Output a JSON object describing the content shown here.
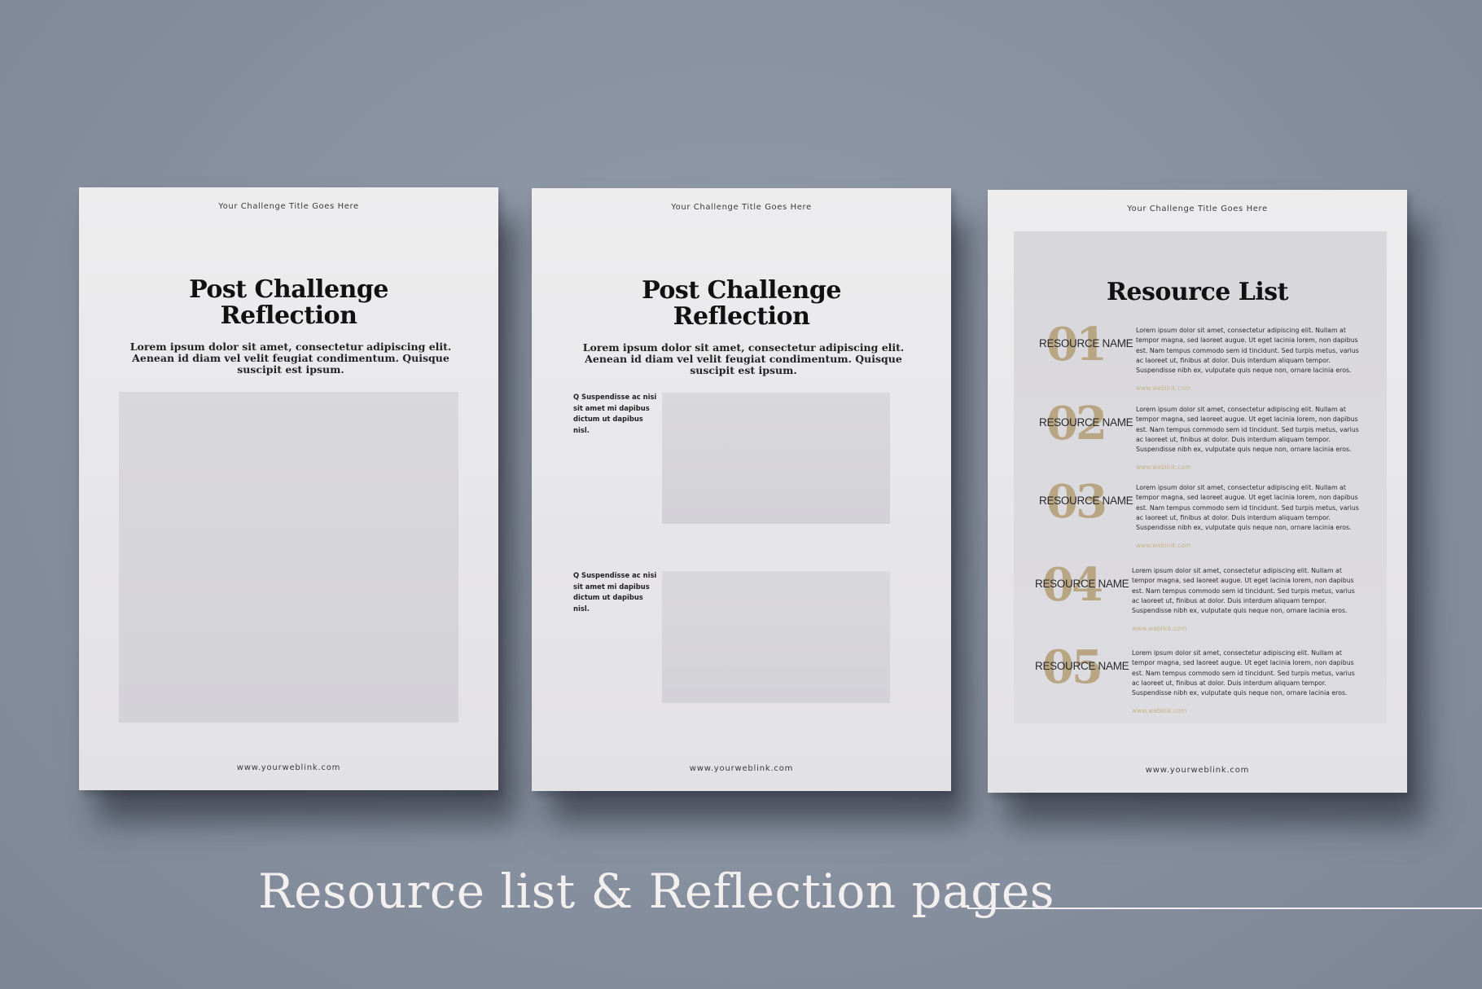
{
  "pages": [
    {
      "header": "Your Challenge Title Goes Here",
      "title_line1": "Post Challenge",
      "title_line2": "Reflection",
      "intro": "Lorem ipsum dolor sit amet, consectetur adipiscing elit. Aenean id diam vel velit feugiat condimentum. Quisque suscipit est ipsum.",
      "footer": "www.yourweblink.com"
    },
    {
      "header": "Your Challenge Title Goes Here",
      "title_line1": "Post Challenge",
      "title_line2": "Reflection",
      "intro": "Lorem ipsum dolor sit amet, consectetur adipiscing elit. Aenean id diam vel velit feugiat condimentum. Quisque suscipit est ipsum.",
      "questions": [
        "Q Suspendisse ac nisi sit amet mi dapibus dictum ut dapibus nisl.",
        "Q Suspendisse ac nisi sit amet mi dapibus dictum ut dapibus nisl."
      ],
      "footer": "www.yourweblink.com"
    },
    {
      "header": "Your Challenge Title Goes Here",
      "title": "Resource List",
      "resources": [
        {
          "number": "01",
          "name": "RESOURCE NAME",
          "description": "Lorem ipsum dolor sit amet, consectetur adipiscing elit. Nullam at tempor magna, sed laoreet augue. Ut eget lacinia lorem, non dapibus est. Nam tempus commodo sem id tincidunt. Sed turpis metus, varius ac laoreet ut, finibus at dolor. Duis interdum aliquam tempor. Suspendisse nibh ex, vulputate quis neque non, ornare lacinia eros.",
          "link": "www.weblink.com"
        },
        {
          "number": "02",
          "name": "RESOURCE NAME",
          "description": "Lorem ipsum dolor sit amet, consectetur adipiscing elit. Nullam at tempor magna, sed laoreet augue. Ut eget lacinia lorem, non dapibus est. Nam tempus commodo sem id tincidunt. Sed turpis metus, varius ac laoreet ut, finibus at dolor. Duis interdum aliquam tempor. Suspendisse nibh ex, vulputate quis neque non, ornare lacinia eros.",
          "link": "www.weblink.com"
        },
        {
          "number": "03",
          "name": "RESOURCE NAME",
          "description": "Lorem ipsum dolor sit amet, consectetur adipiscing elit. Nullam at tempor magna, sed laoreet augue. Ut eget lacinia lorem, non dapibus est. Nam tempus commodo sem id tincidunt. Sed turpis metus, varius ac laoreet ut, finibus at dolor. Duis interdum aliquam tempor. Suspendisse nibh ex, vulputate quis neque non, ornare lacinia eros.",
          "link": "www.weblink.com"
        },
        {
          "number": "04",
          "name": "RESOURCE NAME",
          "description": "Lorem ipsum dolor sit amet, consectetur adipiscing elit. Nullam at tempor magna, sed laoreet augue. Ut eget lacinia lorem, non dapibus est. Nam tempus commodo sem id tincidunt. Sed turpis metus, varius ac laoreet ut, finibus at dolor. Duis interdum aliquam tempor. Suspendisse nibh ex, vulputate quis neque non, ornare lacinia eros.",
          "link": "www.weblink.com"
        },
        {
          "number": "05",
          "name": "RESOURCE NAME",
          "description": "Lorem ipsum dolor sit amet, consectetur adipiscing elit. Nullam at tempor magna, sed laoreet augue. Ut eget lacinia lorem, non dapibus est. Nam tempus commodo sem id tincidunt. Sed turpis metus, varius ac laoreet ut, finibus at dolor. Duis interdum aliquam tempor. Suspendisse nibh ex, vulputate quis neque non, ornare lacinia eros.",
          "link": "www.weblink.com"
        }
      ],
      "footer": "www.yourweblink.com"
    }
  ],
  "caption": "Resource list & Reflection pages",
  "colors": {
    "background": "#8a93a3",
    "paper": "#e8e7ea",
    "placeholder": "#d6d5d9",
    "gold_accent": "#b5a07a",
    "caption_text": "#f2efee"
  }
}
